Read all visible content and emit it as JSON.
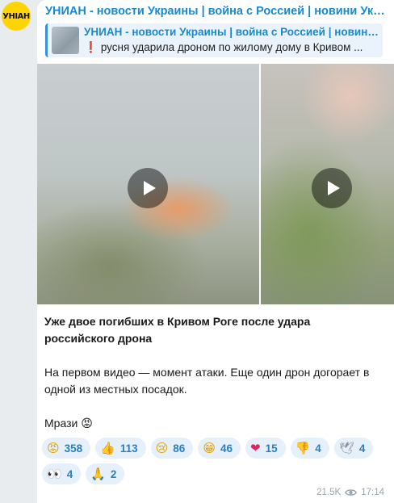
{
  "avatar": {
    "label": "УНІАН"
  },
  "post": {
    "channel": "УНИАН - новости Украины | война с Россией | новини Україні...",
    "reply": {
      "title": "УНИАН - новости Украины | война с Россией | новини...",
      "marker": "❗",
      "text": "русня ударила дроном по жилому дому в Кривом ..."
    },
    "headline": "Уже двое погибших в Кривом Роге после удара российского дрона",
    "body": "На первом видео — момент атаки. Еще один дрон догорает в одной из местных посадок.",
    "signoff": "Мрази 😡"
  },
  "reactions": [
    {
      "icon": "angry-face-emoji",
      "emoji": "😡",
      "count": "358"
    },
    {
      "icon": "thumbs-up-emoji",
      "emoji": "👍",
      "count": "113"
    },
    {
      "icon": "crying-face-emoji",
      "emoji": "😢",
      "count": "86"
    },
    {
      "icon": "grinning-face-emoji",
      "emoji": "😁",
      "count": "46"
    },
    {
      "icon": "red-heart-emoji",
      "emoji": "❤",
      "count": "15"
    },
    {
      "icon": "thumbs-down-emoji",
      "emoji": "👎",
      "count": "4"
    },
    {
      "icon": "dove-emoji",
      "emoji": "🕊",
      "count": "4"
    },
    {
      "icon": "eyes-emoji",
      "emoji": "👀",
      "count": "4"
    },
    {
      "icon": "folded-hands-emoji",
      "emoji": "🙏",
      "count": "2"
    }
  ],
  "footer": {
    "views": "21.5K",
    "time": "17:14"
  }
}
